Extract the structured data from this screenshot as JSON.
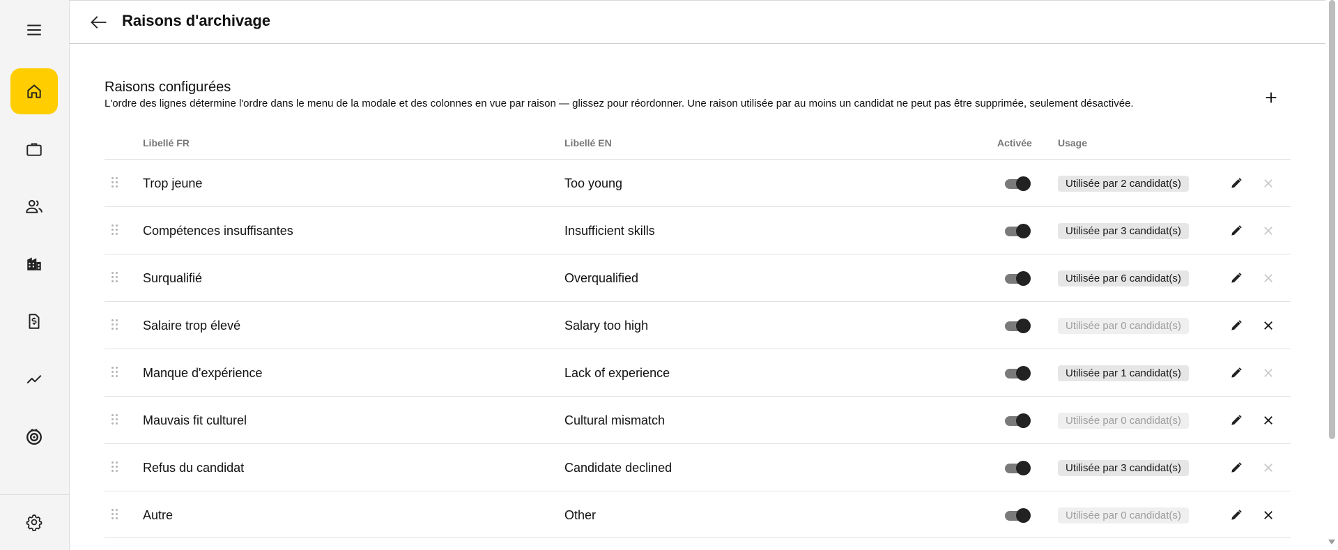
{
  "sidebar": {
    "items": [
      {
        "icon": "menu-icon"
      },
      {
        "icon": "home-icon",
        "active": true
      },
      {
        "icon": "briefcase-icon"
      },
      {
        "icon": "people-icon"
      },
      {
        "icon": "building-icon"
      },
      {
        "icon": "invoice-icon"
      },
      {
        "icon": "trending-icon"
      },
      {
        "icon": "camera-lens-icon"
      },
      {
        "icon": "gear-icon"
      }
    ],
    "accent_color": "#ffcd00"
  },
  "header": {
    "title": "Raisons d'archivage"
  },
  "section": {
    "title": "Raisons configurées",
    "description": "L'ordre des lignes détermine l'ordre dans le menu de la modale et des colonnes en vue par raison — glissez pour réordonner. Une raison utilisée par au moins un candidat ne peut pas être supprimée, seulement désactivée."
  },
  "table": {
    "headers": {
      "label_fr": "Libellé FR",
      "label_en": "Libellé EN",
      "enabled": "Activée",
      "usage": "Usage"
    },
    "rows": [
      {
        "label_fr": "Trop jeune",
        "label_en": "Too young",
        "enabled": true,
        "usage": "Utilisée par 2 candidat(s)",
        "used": true
      },
      {
        "label_fr": "Compétences insuffisantes",
        "label_en": "Insufficient skills",
        "enabled": true,
        "usage": "Utilisée par 3 candidat(s)",
        "used": true
      },
      {
        "label_fr": "Surqualifié",
        "label_en": "Overqualified",
        "enabled": true,
        "usage": "Utilisée par 6 candidat(s)",
        "used": true
      },
      {
        "label_fr": "Salaire trop élevé",
        "label_en": "Salary too high",
        "enabled": true,
        "usage": "Utilisée par 0 candidat(s)",
        "used": false
      },
      {
        "label_fr": "Manque d'expérience",
        "label_en": "Lack of experience",
        "enabled": true,
        "usage": "Utilisée par 1 candidat(s)",
        "used": true
      },
      {
        "label_fr": "Mauvais fit culturel",
        "label_en": "Cultural mismatch",
        "enabled": true,
        "usage": "Utilisée par 0 candidat(s)",
        "used": false
      },
      {
        "label_fr": "Refus du candidat",
        "label_en": "Candidate declined",
        "enabled": true,
        "usage": "Utilisée par 3 candidat(s)",
        "used": true
      },
      {
        "label_fr": "Autre",
        "label_en": "Other",
        "enabled": true,
        "usage": "Utilisée par 0 candidat(s)",
        "used": false
      }
    ]
  }
}
